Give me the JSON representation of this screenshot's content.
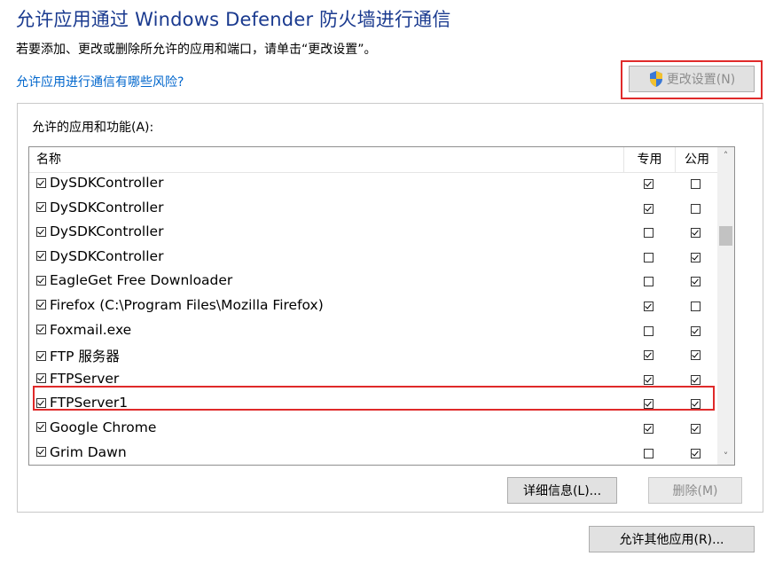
{
  "header": {
    "title": "允许应用通过 Windows Defender 防火墙进行通信",
    "subtitle": "若要添加、更改或删除所允许的应用和端口，请单击“更改设置”。",
    "risk_link": "允许应用进行通信有哪些风险?",
    "change_settings_label": "更改设置(N)"
  },
  "apps_group": {
    "label": "允许的应用和功能(A):",
    "columns": {
      "name": "名称",
      "private": "专用",
      "public": "公用"
    },
    "rows": [
      {
        "name": "DySDKController",
        "enabled": true,
        "private": true,
        "public": false
      },
      {
        "name": "DySDKController",
        "enabled": true,
        "private": true,
        "public": false
      },
      {
        "name": "DySDKController",
        "enabled": true,
        "private": false,
        "public": true
      },
      {
        "name": "DySDKController",
        "enabled": true,
        "private": false,
        "public": true
      },
      {
        "name": "EagleGet Free Downloader",
        "enabled": true,
        "private": false,
        "public": true
      },
      {
        "name": "Firefox (C:\\Program Files\\Mozilla Firefox)",
        "enabled": true,
        "private": true,
        "public": false
      },
      {
        "name": "Foxmail.exe",
        "enabled": true,
        "private": false,
        "public": true
      },
      {
        "name": "FTP 服务器",
        "enabled": true,
        "private": true,
        "public": true
      },
      {
        "name": "FTPServer",
        "enabled": true,
        "private": true,
        "public": true
      },
      {
        "name": "FTPServer1",
        "enabled": true,
        "private": true,
        "public": true
      },
      {
        "name": "Google Chrome",
        "enabled": true,
        "private": true,
        "public": true
      },
      {
        "name": "Grim Dawn",
        "enabled": true,
        "private": false,
        "public": true
      }
    ],
    "details_label": "详细信息(L)...",
    "remove_label": "删除(M)"
  },
  "footer": {
    "allow_other_label": "允许其他应用(R)..."
  },
  "icons": {
    "uac": "uac-shield-icon",
    "scroll_up": "chevron-up-icon",
    "scroll_down": "chevron-down-icon"
  },
  "colors": {
    "title": "#1a3a8f",
    "link": "#0066cc",
    "highlight": "#e02a2a"
  }
}
